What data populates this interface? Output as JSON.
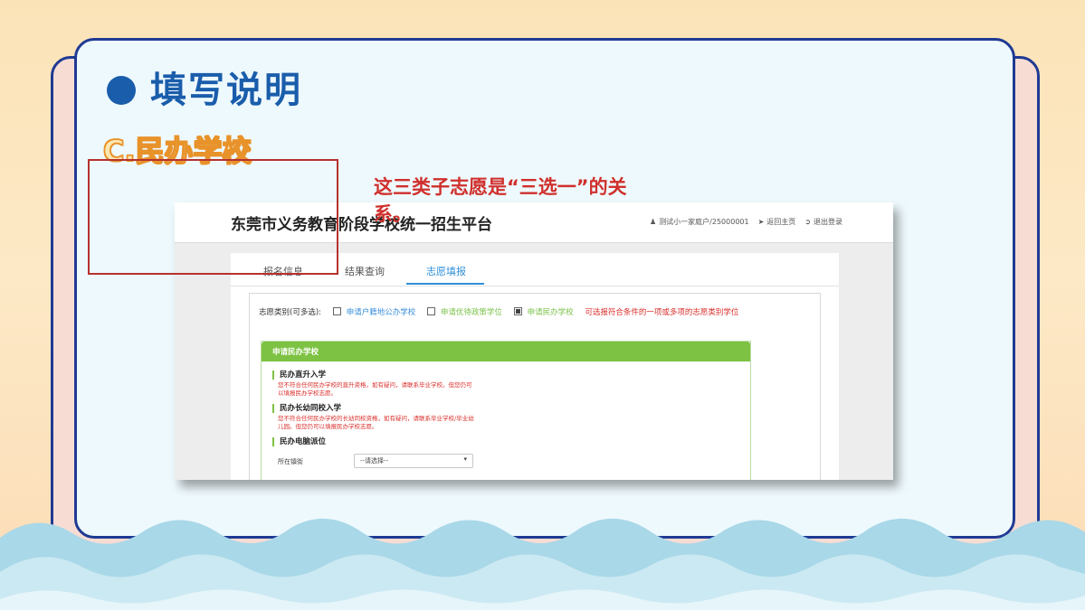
{
  "slide": {
    "title": "填写说明",
    "subtitle": "C.民办学校"
  },
  "screenshot": {
    "platform_title": "东莞市义务教育阶段学校统一招生平台",
    "user": "测试小一家庭户/25000001",
    "home_link": "返回主页",
    "logout_link": "退出登录",
    "tabs": [
      "报名信息",
      "结果查询",
      "志愿填报"
    ],
    "active_tab": "志愿填报",
    "category_label": "志愿类别(可多选):",
    "options": [
      {
        "label": "申请户籍地公办学校",
        "checked": false
      },
      {
        "label": "申请优待政策学位",
        "checked": false
      },
      {
        "label": "申请民办学校",
        "checked": true
      }
    ],
    "hint": "可选报符合条件的一项或多项的志愿类别学位",
    "section_header": "申请民办学校",
    "sections": [
      {
        "title": "民办直升入学",
        "note": "您不符合任何民办学校的直升资格，如有疑问，请联系毕业学校。但您仍可以填报民办学校志愿。"
      },
      {
        "title": "民办长幼同校入学",
        "note": "您不符合任何民办学校的长幼同校资格，如有疑问，请联系毕业学校/毕业幼儿园。但您仍可以填报民办学校志愿。"
      },
      {
        "title": "民办电脑派位",
        "note": ""
      }
    ],
    "district_label": "所在镇街",
    "district_select": "--请选择--"
  },
  "annotation": "这三类子志愿是“三选一”的关系。",
  "colors": {
    "title_blue": "#1a5dab",
    "subtitle_orange": "#e8922a",
    "accent_green": "#7dc242",
    "annotation_red": "#d0302c",
    "frame_red": "#b5322e"
  }
}
